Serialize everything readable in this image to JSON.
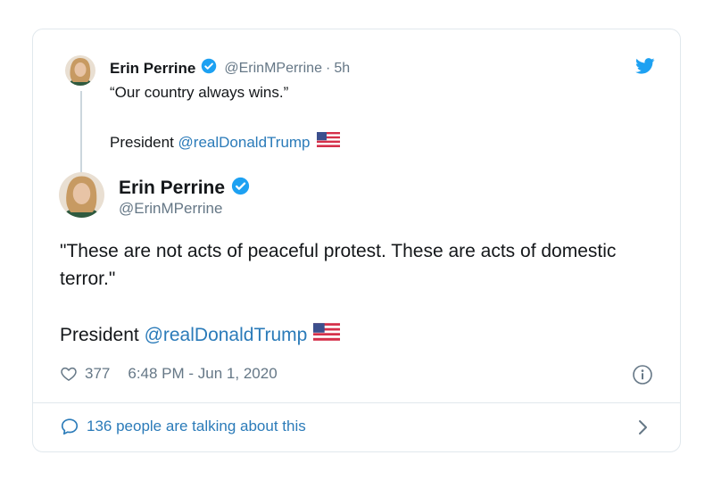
{
  "parent_tweet": {
    "author_name": "Erin Perrine",
    "handle": "@ErinMPerrine",
    "separator": "·",
    "time": "5h",
    "text_line1": "“Our country always wins.”",
    "text_line2_prefix": "President ",
    "mention": "@realDonaldTrump"
  },
  "main_tweet": {
    "author_name": "Erin Perrine",
    "handle": "@ErinMPerrine",
    "body": "\"These are not acts of peaceful protest. These are acts of domestic terror.\"",
    "body2_prefix": "President ",
    "mention": "@realDonaldTrump",
    "like_count": "377",
    "timestamp": "6:48 PM - Jun 1, 2020"
  },
  "footer": {
    "talking_text": "136 people are talking about this"
  },
  "colors": {
    "link_blue": "#2b7bb9",
    "verified_blue": "#1da1f2",
    "muted_gray": "#657786",
    "border": "#e1e8ed"
  },
  "icons": {
    "verified": "verified-badge-icon",
    "twitter": "twitter-bird-icon",
    "heart": "heart-icon",
    "info": "info-icon",
    "comment": "comment-bubble-icon",
    "chevron": "chevron-right-icon",
    "flag": "us-flag-icon"
  }
}
